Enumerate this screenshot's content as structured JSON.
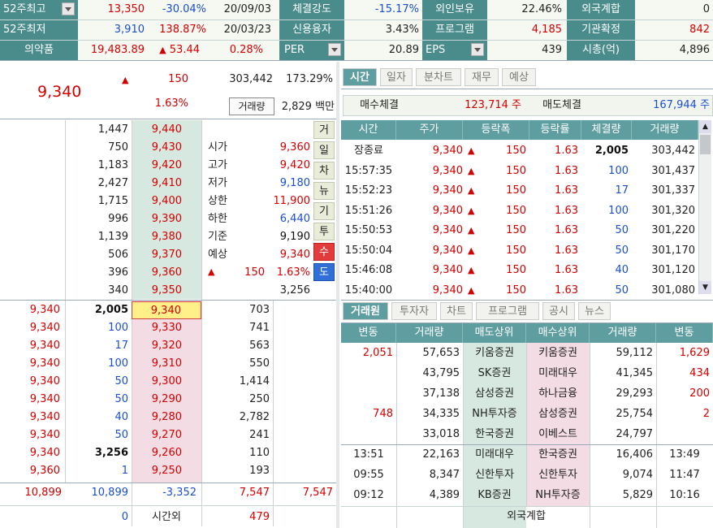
{
  "summary": {
    "row1": [
      {
        "label": "52주최고",
        "value": "13,350",
        "pct": "-30.04%",
        "date": "20/09/03"
      },
      {
        "label": "체결강도",
        "value": "-15.17%"
      },
      {
        "label": "외인보유",
        "value": "22.46%"
      },
      {
        "label": "외국계합",
        "value": "0"
      }
    ],
    "row2": [
      {
        "label": "52주최저",
        "value": "3,910",
        "pct": "138.87%",
        "date": "20/03/23"
      },
      {
        "label": "신용융자",
        "value": "3.43%"
      },
      {
        "label": "프로그램",
        "value": "4,185"
      },
      {
        "label": "기관확정",
        "value": "842"
      }
    ],
    "row3": {
      "sector": "의약품",
      "sector_value": "19,483.89",
      "sector_change": "53.44",
      "sector_pct": "0.28%",
      "per_label": "PER",
      "per_value": "20.89",
      "eps_label": "EPS",
      "eps_value": "439",
      "cap_label": "시총(억)",
      "cap_value": "4,896"
    }
  },
  "quote": {
    "price": "9,340",
    "change": "150",
    "volume": "303,442",
    "vol_ratio": "173.29%",
    "pct": "1.63%",
    "vol_tooltip": "거래량",
    "amount": "2,829 백만"
  },
  "orderbook": {
    "asks": [
      {
        "qty": "1,447",
        "price": "9,440"
      },
      {
        "qty": "750",
        "price": "9,430"
      },
      {
        "qty": "1,183",
        "price": "9,420"
      },
      {
        "qty": "2,427",
        "price": "9,410"
      },
      {
        "qty": "1,715",
        "price": "9,400"
      },
      {
        "qty": "996",
        "price": "9,390"
      },
      {
        "qty": "1,139",
        "price": "9,380"
      },
      {
        "qty": "506",
        "price": "9,370"
      },
      {
        "qty": "396",
        "price": "9,360"
      },
      {
        "qty": "340",
        "price": "9,350"
      }
    ],
    "info": [
      {
        "label": "시가",
        "value": "9,360"
      },
      {
        "label": "고가",
        "value": "9,420"
      },
      {
        "label": "저가",
        "value": "9,180"
      },
      {
        "label": "상한",
        "value": "11,900"
      },
      {
        "label": "하한",
        "value": "6,440"
      },
      {
        "label": "기준",
        "value": "9,190"
      },
      {
        "label": "예상",
        "value": "9,340"
      }
    ],
    "expected_change": "150",
    "expected_pct": "1.63%",
    "expected_qty": "3,256",
    "side_buttons": [
      "거",
      "일",
      "차",
      "뉴",
      "기",
      "투",
      "수",
      "도"
    ],
    "bids": [
      {
        "exec": "9,340",
        "eqty": "2,005",
        "price": "9,340",
        "qty": "703"
      },
      {
        "exec": "9,340",
        "eqty": "100",
        "price": "9,330",
        "qty": "741"
      },
      {
        "exec": "9,340",
        "eqty": "17",
        "price": "9,320",
        "qty": "563"
      },
      {
        "exec": "9,340",
        "eqty": "100",
        "price": "9,310",
        "qty": "550"
      },
      {
        "exec": "9,340",
        "eqty": "50",
        "price": "9,300",
        "qty": "1,414"
      },
      {
        "exec": "9,340",
        "eqty": "50",
        "price": "9,290",
        "qty": "250"
      },
      {
        "exec": "9,340",
        "eqty": "40",
        "price": "9,280",
        "qty": "2,782"
      },
      {
        "exec": "9,340",
        "eqty": "50",
        "price": "9,270",
        "qty": "241"
      },
      {
        "exec": "9,340",
        "eqty": "3,256",
        "price": "9,260",
        "qty": "110"
      },
      {
        "exec": "9,360",
        "eqty": "1",
        "price": "9,250",
        "qty": "193"
      }
    ],
    "totals": [
      "10,899",
      "10,899",
      "-3,352",
      "7,547",
      "7,547"
    ],
    "after_hours": {
      "left": "0",
      "label": "시간외",
      "right": "479"
    }
  },
  "trades": {
    "tabs": [
      "시간",
      "일자",
      "분차트",
      "재무",
      "예상"
    ],
    "buy_label": "매수체결",
    "buy_value": "123,714 주",
    "sell_label": "매도체결",
    "sell_value": "167,944 주",
    "headers": [
      "시간",
      "주가",
      "등락폭",
      "등락률",
      "체결량",
      "거래량"
    ],
    "rows": [
      {
        "time": "장종료",
        "price": "9,340",
        "chg": "150",
        "pct": "1.63",
        "qty": "2,005",
        "vol": "303,442"
      },
      {
        "time": "15:57:35",
        "price": "9,340",
        "chg": "150",
        "pct": "1.63",
        "qty": "100",
        "vol": "301,437"
      },
      {
        "time": "15:52:23",
        "price": "9,340",
        "chg": "150",
        "pct": "1.63",
        "qty": "17",
        "vol": "301,337"
      },
      {
        "time": "15:51:26",
        "price": "9,340",
        "chg": "150",
        "pct": "1.63",
        "qty": "100",
        "vol": "301,320"
      },
      {
        "time": "15:50:53",
        "price": "9,340",
        "chg": "150",
        "pct": "1.63",
        "qty": "50",
        "vol": "301,220"
      },
      {
        "time": "15:50:04",
        "price": "9,340",
        "chg": "150",
        "pct": "1.63",
        "qty": "50",
        "vol": "301,170"
      },
      {
        "time": "15:46:08",
        "price": "9,340",
        "chg": "150",
        "pct": "1.63",
        "qty": "40",
        "vol": "301,120"
      },
      {
        "time": "15:40:00",
        "price": "9,340",
        "chg": "150",
        "pct": "1.63",
        "qty": "50",
        "vol": "301,080"
      }
    ]
  },
  "brokers": {
    "tabs": [
      "거래원",
      "투자자",
      "차트",
      "프로그램",
      "공시",
      "뉴스"
    ],
    "headers": [
      "변동",
      "거래량",
      "매도상위",
      "매수상위",
      "거래량",
      "변동"
    ],
    "rows": [
      {
        "schg": "2,051",
        "svol": "57,653",
        "sell": "키움증권",
        "buy": "키움증권",
        "bvol": "59,112",
        "bchg": "1,629"
      },
      {
        "schg": "",
        "svol": "43,795",
        "sell": "SK증권",
        "buy": "미래대우",
        "bvol": "41,345",
        "bchg": "434"
      },
      {
        "schg": "",
        "svol": "37,138",
        "sell": "삼성증권",
        "buy": "하나금융",
        "bvol": "29,293",
        "bchg": "200"
      },
      {
        "schg": "748",
        "svol": "34,335",
        "sell": "NH투자증",
        "buy": "삼성증권",
        "bvol": "25,754",
        "bchg": "2"
      },
      {
        "schg": "",
        "svol": "33,018",
        "sell": "한국증권",
        "buy": "이베스트",
        "bvol": "24,797",
        "bchg": ""
      }
    ],
    "recent": [
      {
        "t1": "13:51",
        "svol": "22,163",
        "sell": "미래대우",
        "buy": "한국증권",
        "bvol": "16,406",
        "t2": "13:49"
      },
      {
        "t1": "09:55",
        "svol": "8,347",
        "sell": "신한투자",
        "buy": "신한투자",
        "bvol": "9,074",
        "t2": "11:47"
      },
      {
        "t1": "09:12",
        "svol": "4,389",
        "sell": "KB증권",
        "buy": "NH투자증",
        "bvol": "5,829",
        "t2": "10:16"
      }
    ],
    "foreign_label": "외국계합"
  }
}
